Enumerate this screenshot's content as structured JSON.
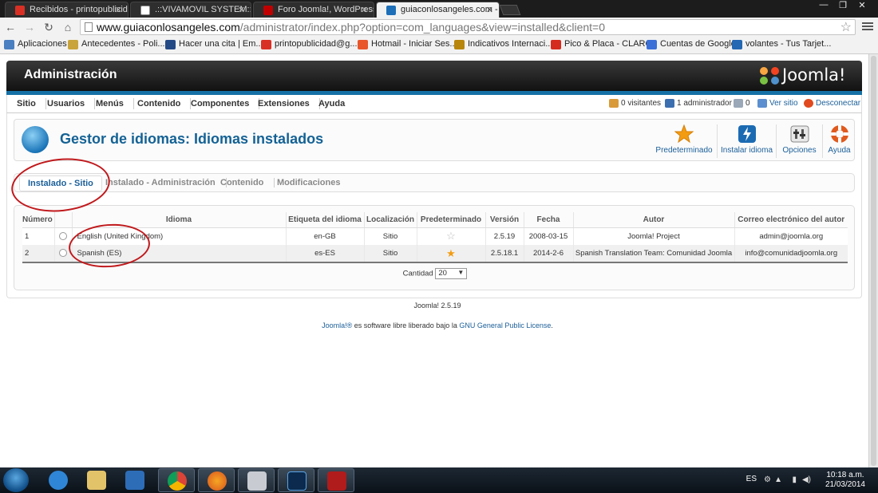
{
  "browser": {
    "tabs": [
      {
        "title": "Recibidos - printopublicid",
        "favicon_color": "#d93025"
      },
      {
        "title": ".::VIVAMOVIL SYSTEM::.",
        "favicon_color": "#ffffff"
      },
      {
        "title": "Foro Joomla!, WordPress",
        "favicon_color": "#c00000"
      },
      {
        "title": "guiaconlosangeles.com -",
        "favicon_color": "#1d6fb8"
      }
    ],
    "url_host": "www.guiaconlosangeles.com",
    "url_path": "/administrator/index.php?option=com_languages&view=installed&client=0",
    "bookmarks": [
      {
        "label": "Aplicaciones",
        "icon_color": "#4a7fc1"
      },
      {
        "label": "Antecedentes - Poli...",
        "icon_color": "#c9a43a"
      },
      {
        "label": "Hacer una cita | Em...",
        "icon_color": "#244a86"
      },
      {
        "label": "printopublicidad@g...",
        "icon_color": "#d93025"
      },
      {
        "label": "Hotmail - Iniciar Ses...",
        "icon_color": "#e8562a"
      },
      {
        "label": "Indicativos Internaci...",
        "icon_color": "#b8860b"
      },
      {
        "label": "Pico & Placa - CLARO",
        "icon_color": "#d52b1e"
      },
      {
        "label": "Cuentas de Google",
        "icon_color": "#3b6fd8"
      },
      {
        "label": "volantes - Tus Tarjet...",
        "icon_color": "#2467b3"
      }
    ]
  },
  "admin": {
    "header_title": "Administración",
    "logo_text": "Joomla!",
    "menu": [
      "Sitio",
      "Usuarios",
      "Menús",
      "Contenido",
      "Componentes",
      "Extensiones",
      "Ayuda"
    ],
    "status": {
      "visitors": "0 visitantes",
      "admins": "1 administrador",
      "messages": "0",
      "view_site": "Ver sitio",
      "logout": "Desconectar"
    },
    "page_title": "Gestor de idiomas: Idiomas instalados",
    "toolbar": [
      {
        "label": "Predeterminado",
        "icon": "star-icon"
      },
      {
        "label": "Instalar idioma",
        "icon": "install-icon"
      },
      {
        "label": "Opciones",
        "icon": "options-icon"
      },
      {
        "label": "Ayuda",
        "icon": "help-icon"
      }
    ],
    "subtabs": [
      "Instalado - Sitio",
      "Instalado - Administración",
      "Contenido",
      "Modificaciones"
    ],
    "table": {
      "headers": [
        "Número",
        "",
        "Idioma",
        "Etiqueta del idioma",
        "Localización",
        "Predeterminado",
        "Versión",
        "Fecha",
        "Autor",
        "Correo electrónico del autor"
      ],
      "rows": [
        {
          "num": "1",
          "language": "English (United Kingdom)",
          "tag": "en-GB",
          "location": "Sitio",
          "default": false,
          "version": "2.5.19",
          "date": "2008-03-15",
          "author": "Joomla! Project",
          "email": "admin@joomla.org"
        },
        {
          "num": "2",
          "language": "Spanish (ES)",
          "tag": "es-ES",
          "location": "Sitio",
          "default": true,
          "version": "2.5.18.1",
          "date": "2014-2-6",
          "author": "Spanish Translation Team: Comunidad Joomla",
          "email": "info@comunidadjoomla.org"
        }
      ]
    },
    "pager": {
      "label": "Cantidad",
      "value": "20"
    },
    "footer_version": "Joomla! 2.5.19",
    "footer_license_prefix": "Joomla!®",
    "footer_license_middle": " es software libre liberado bajo la ",
    "footer_license_link": "GNU General Public License",
    "footer_license_suffix": "."
  },
  "taskbar": {
    "language": "ES",
    "time": "10:18 a.m.",
    "date": "21/03/2014"
  }
}
